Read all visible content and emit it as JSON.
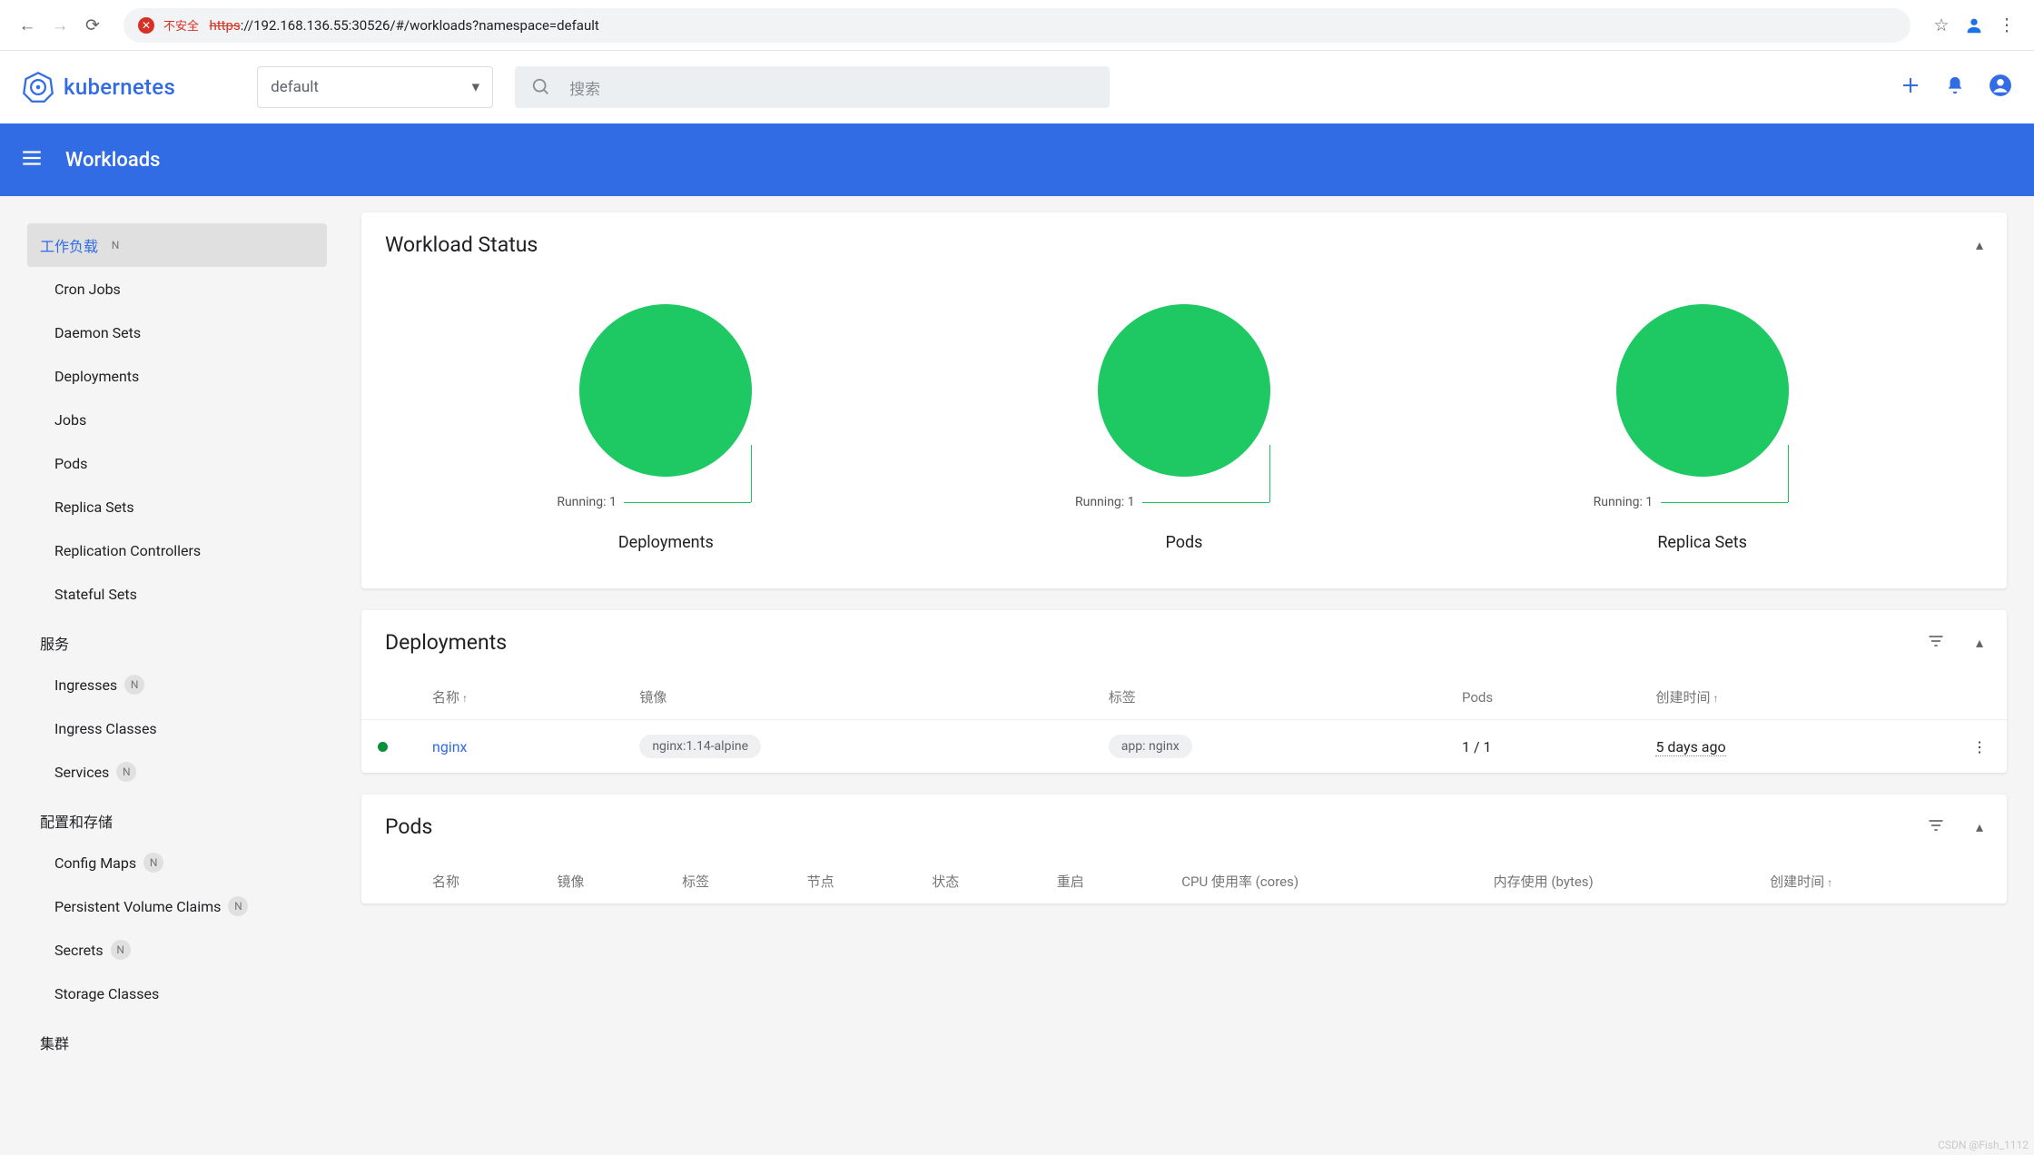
{
  "browser": {
    "url_insecure_label": "不安全",
    "url_proto": "https",
    "url_rest": "://192.168.136.55:30526/#/workloads?namespace=default"
  },
  "brand": {
    "name": "kubernetes"
  },
  "namespace": {
    "selected": "default"
  },
  "search": {
    "placeholder": "搜索"
  },
  "titlebar": {
    "title": "Workloads"
  },
  "sidebar": {
    "workloads": {
      "label": "工作负载",
      "badge": "N"
    },
    "cron_jobs": "Cron Jobs",
    "daemon_sets": "Daemon Sets",
    "deployments": "Deployments",
    "jobs": "Jobs",
    "pods": "Pods",
    "replica_sets": "Replica Sets",
    "replication_controllers": "Replication Controllers",
    "stateful_sets": "Stateful Sets",
    "services_header": "服务",
    "ingresses": {
      "label": "Ingresses",
      "badge": "N"
    },
    "ingress_classes": "Ingress Classes",
    "services": {
      "label": "Services",
      "badge": "N"
    },
    "config_header": "配置和存储",
    "config_maps": {
      "label": "Config Maps",
      "badge": "N"
    },
    "pvc": {
      "label": "Persistent Volume Claims",
      "badge": "N"
    },
    "secrets": {
      "label": "Secrets",
      "badge": "N"
    },
    "storage_classes": "Storage Classes",
    "cluster_header": "集群"
  },
  "workload_status": {
    "title": "Workload Status",
    "charts": {
      "deployments": {
        "legend": "Running: 1",
        "label": "Deployments"
      },
      "pods": {
        "legend": "Running: 1",
        "label": "Pods"
      },
      "replicasets": {
        "legend": "Running: 1",
        "label": "Replica Sets"
      }
    }
  },
  "chart_data": [
    {
      "type": "pie",
      "title": "Deployments",
      "categories": [
        "Running"
      ],
      "values": [
        1
      ]
    },
    {
      "type": "pie",
      "title": "Pods",
      "categories": [
        "Running"
      ],
      "values": [
        1
      ]
    },
    {
      "type": "pie",
      "title": "Replica Sets",
      "categories": [
        "Running"
      ],
      "values": [
        1
      ]
    }
  ],
  "deployments_card": {
    "title": "Deployments",
    "columns": {
      "name": "名称",
      "image": "镜像",
      "labels": "标签",
      "pods": "Pods",
      "created": "创建时间"
    },
    "row": {
      "name": "nginx",
      "image": "nginx:1.14-alpine",
      "label": "app: nginx",
      "pods": "1 / 1",
      "created": "5 days ago"
    }
  },
  "pods_card": {
    "title": "Pods",
    "columns": {
      "name": "名称",
      "image": "镜像",
      "labels": "标签",
      "node": "节点",
      "status": "状态",
      "restarts": "重启",
      "cpu": "CPU 使用率 (cores)",
      "memory": "内存使用 (bytes)",
      "created": "创建时间"
    }
  },
  "colors": {
    "accent": "#326ce5",
    "success": "#1ec963"
  },
  "watermark": "CSDN @Fish_1112"
}
